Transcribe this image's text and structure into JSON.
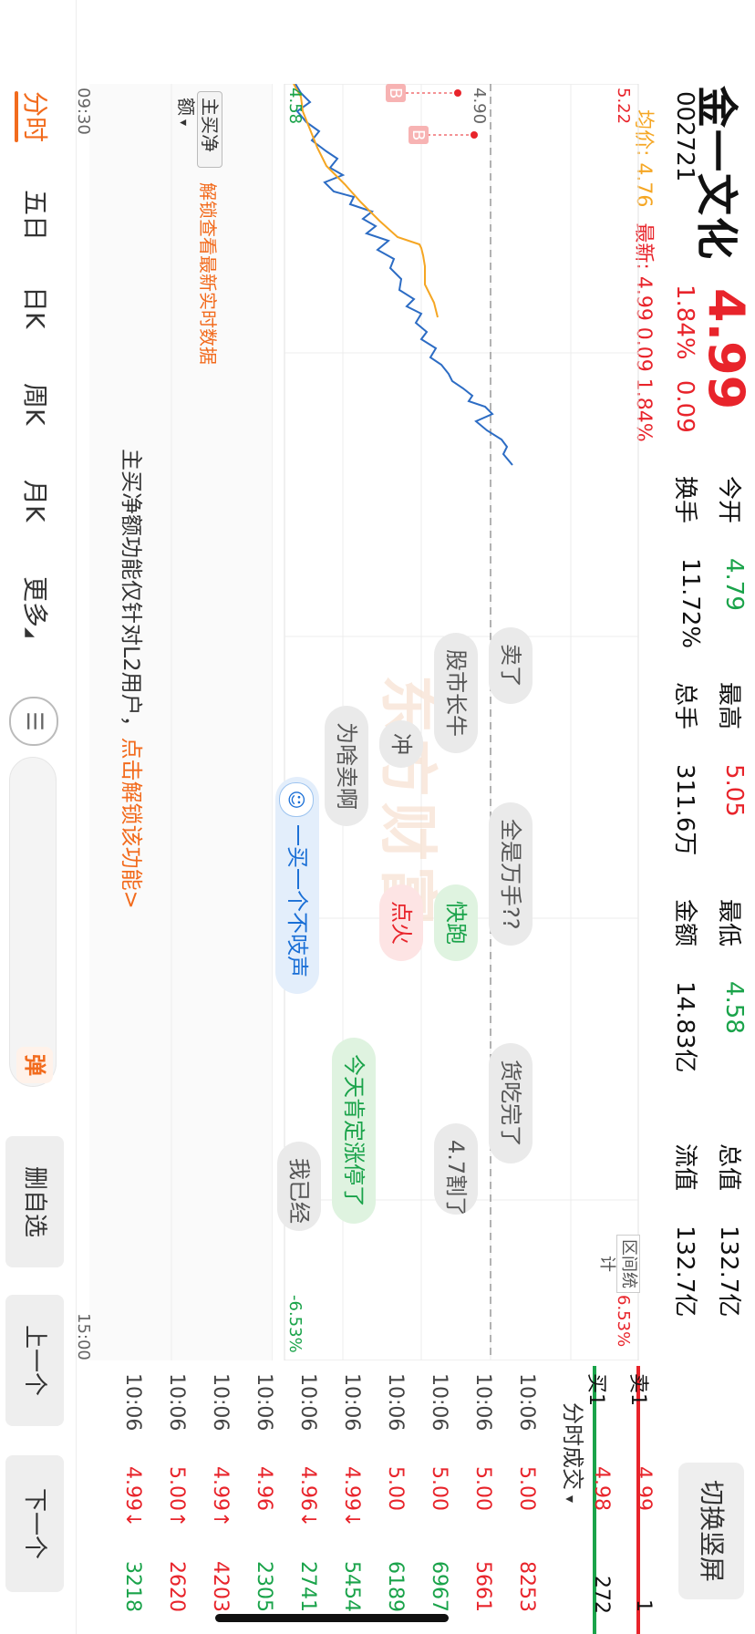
{
  "header": {
    "name": "金一文化",
    "price": "4.99",
    "code": "002721",
    "pct": "1.84%",
    "change": "0.09",
    "stats": [
      {
        "label": "今开",
        "value": "4.79",
        "color": "#1aa34a"
      },
      {
        "label": "换手",
        "value": "11.72%",
        "color": "#111111"
      },
      {
        "label": "最高",
        "value": "5.05",
        "color": "#e8242b"
      },
      {
        "label": "总手",
        "value": "311.6万",
        "color": "#111111"
      },
      {
        "label": "最低",
        "value": "4.58",
        "color": "#1aa34a"
      },
      {
        "label": "金额",
        "value": "14.83亿",
        "color": "#111111"
      },
      {
        "label": "总值",
        "value": "132.7亿",
        "color": "#111111"
      },
      {
        "label": "流值",
        "value": "132.7亿",
        "color": "#111111"
      }
    ],
    "switch_label": "切换竖屏"
  },
  "chart": {
    "avg_label": "均价:",
    "avg_value": "4.76",
    "latest_label": "最新:",
    "latest_value": "4.99 0.09 1.84%",
    "y_top": "5.22",
    "y_mid": "4.90",
    "y_bottom": "4.58",
    "pct_top": "6.53%",
    "pct_bottom": "-6.53%",
    "time_start": "09:30",
    "time_end": "15:00",
    "range_stats": "区间统计",
    "watermark": "东方财富",
    "net_label": "主买净额",
    "unlock_hint": "解锁查看最新实时数据",
    "l2_notice": "主买净额功能仅针对L2用户，",
    "l2_link": "点击解锁该功能>",
    "buy_marker": "B"
  },
  "bullets": [
    {
      "text": "卖了",
      "style": "grey"
    },
    {
      "text": "股市长牛",
      "style": "grey"
    },
    {
      "text": "冲",
      "style": "grey"
    },
    {
      "text": "为啥卖啊",
      "style": "grey"
    },
    {
      "text": "全是万手??",
      "style": "grey"
    },
    {
      "text": "一买一个不吱声",
      "style": "blue"
    },
    {
      "text": "快跑",
      "style": "green"
    },
    {
      "text": "点火",
      "style": "red"
    },
    {
      "text": "货吃完了",
      "style": "grey"
    },
    {
      "text": "今天肯定涨停了",
      "style": "green"
    },
    {
      "text": "4.7割了",
      "style": "grey"
    },
    {
      "text": "我已经",
      "style": "grey"
    }
  ],
  "tabs": [
    "分时",
    "五日",
    "日K",
    "周K",
    "月K",
    "更多"
  ],
  "bottom": {
    "danmu_badge": "弹",
    "remove_fav": "删自选",
    "prev": "上一个",
    "next": "下一个"
  },
  "trades": {
    "title": "分时成交",
    "sell1_label": "卖1",
    "sell1_price": "4.99",
    "sell1_vol": "1",
    "buy1_label": "买1",
    "buy1_price": "4.98",
    "buy1_vol": "272",
    "rows": [
      {
        "time": "10:06",
        "price": "5.00",
        "vol": "8253",
        "pc": "#e8242b",
        "vc": "#e8242b"
      },
      {
        "time": "10:06",
        "price": "5.00",
        "vol": "5661",
        "pc": "#e8242b",
        "vc": "#e8242b"
      },
      {
        "time": "10:06",
        "price": "5.00",
        "vol": "6967",
        "pc": "#e8242b",
        "vc": "#1aa34a"
      },
      {
        "time": "10:06",
        "price": "5.00",
        "vol": "6189",
        "pc": "#e8242b",
        "vc": "#1aa34a"
      },
      {
        "time": "10:06",
        "price": "4.99↓",
        "vol": "5454",
        "pc": "#e8242b",
        "vc": "#1aa34a"
      },
      {
        "time": "10:06",
        "price": "4.96↓",
        "vol": "2741",
        "pc": "#e8242b",
        "vc": "#1aa34a"
      },
      {
        "time": "10:06",
        "price": "4.96",
        "vol": "2305",
        "pc": "#e8242b",
        "vc": "#1aa34a"
      },
      {
        "time": "10:06",
        "price": "4.99↑",
        "vol": "4203",
        "pc": "#e8242b",
        "vc": "#e8242b"
      },
      {
        "time": "10:06",
        "price": "5.00↑",
        "vol": "2620",
        "pc": "#e8242b",
        "vc": "#e8242b"
      },
      {
        "time": "10:06",
        "price": "4.99↓",
        "vol": "3218",
        "pc": "#e8242b",
        "vc": "#1aa34a"
      }
    ]
  }
}
